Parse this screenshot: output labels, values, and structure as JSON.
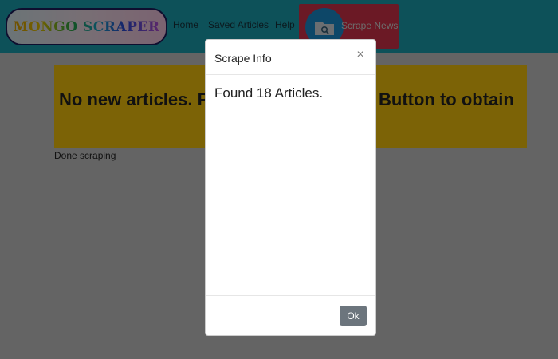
{
  "navbar": {
    "brand": "MONGO SCRAPER",
    "links": [
      "Home",
      "Saved Articles",
      "Help"
    ],
    "scrape_button_label": "Scrape News"
  },
  "main": {
    "jumbotron_left": "No new articles. P",
    "jumbotron_right": "Button to obtain",
    "status": "Done scraping"
  },
  "modal": {
    "title": "Scrape Info",
    "close_symbol": "×",
    "message": "Found 18 Articles.",
    "ok_label": "Ok"
  },
  "colors": {
    "navbar": "#1aa3b3",
    "scrape_button": "#d6334a",
    "jumbotron": "#f8c60d",
    "ok_button": "#6c757d"
  },
  "icons": {
    "scrape": "folder-search-icon",
    "close": "close-icon"
  }
}
